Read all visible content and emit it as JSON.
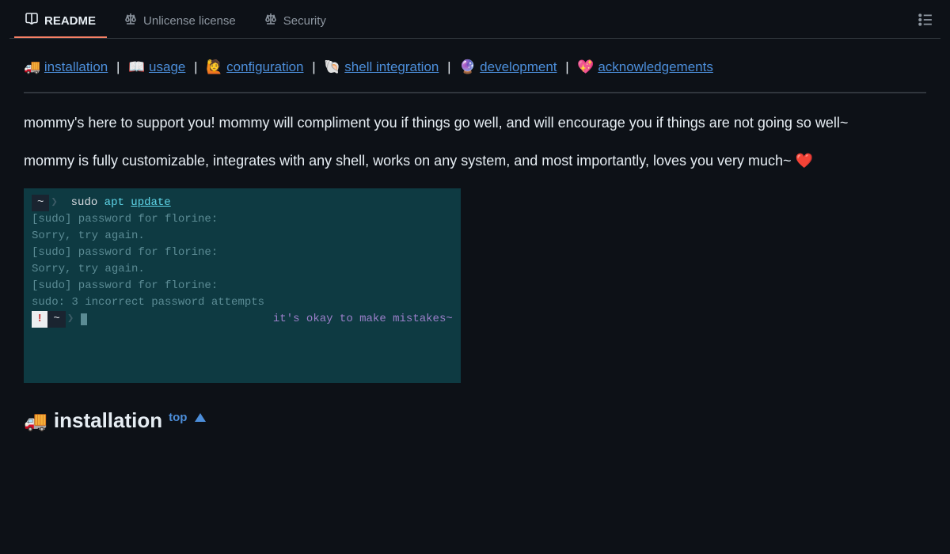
{
  "tabs": {
    "readme": "README",
    "license": "Unlicense license",
    "security": "Security"
  },
  "toc": {
    "installation": {
      "emoji": "🚚",
      "label": "installation"
    },
    "usage": {
      "emoji": "📖",
      "label": "usage"
    },
    "configuration": {
      "emoji": "🙋",
      "label": "configuration"
    },
    "shell": {
      "emoji": "🐚",
      "label": "shell integration"
    },
    "development": {
      "emoji": "🔮",
      "label": "development"
    },
    "ack": {
      "emoji": "💖",
      "label": "acknowledgements"
    }
  },
  "intro": {
    "p1": "mommy's here to support you! mommy will compliment you if things go well, and will encourage you if things are not going so well~",
    "p2_pre": "mommy is fully customizable, integrates with any shell, works on any system, and most importantly, loves you very much~ ",
    "p2_heart": "❤️"
  },
  "terminal": {
    "tilde": "~",
    "sudo": "sudo",
    "apt": "apt",
    "update": "update",
    "l1": "[sudo] password for florine:",
    "l2": "Sorry, try again.",
    "l3": "[sudo] password for florine:",
    "l4": "Sorry, try again.",
    "l5": "[sudo] password for florine:",
    "l6": "sudo: 3 incorrect password attempts",
    "msg": "it's okay to make mistakes~",
    "excl": "!"
  },
  "section": {
    "emoji": "🚚",
    "title": "installation",
    "top": "top"
  }
}
